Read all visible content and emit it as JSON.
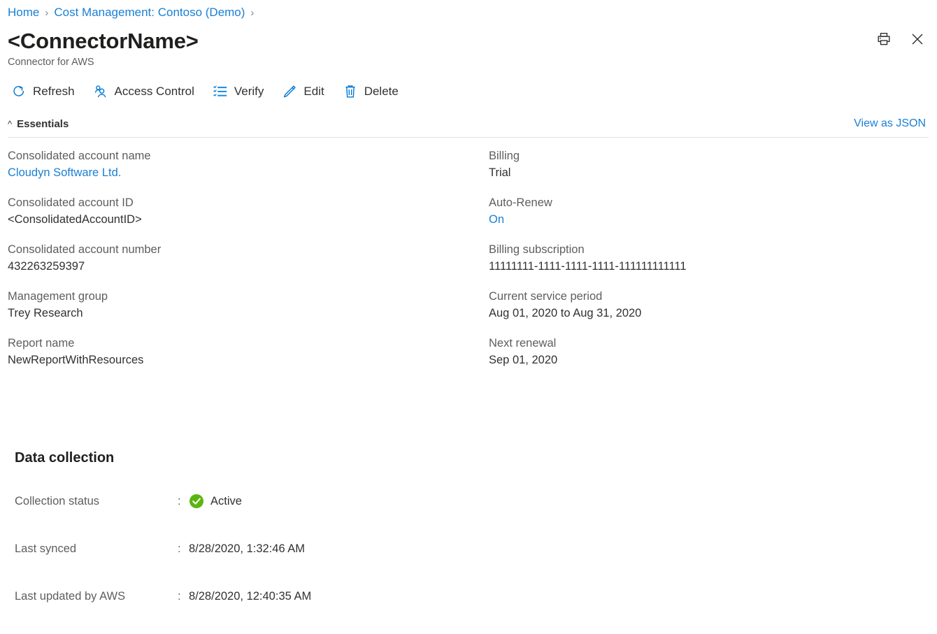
{
  "breadcrumb": {
    "items": [
      {
        "label": "Home"
      },
      {
        "label": "Cost Management: Contoso (Demo)"
      }
    ],
    "separator": "›"
  },
  "header": {
    "title": "<ConnectorName>",
    "subtitle": "Connector for AWS",
    "print_icon": "print-icon",
    "close_icon": "close-icon"
  },
  "command_bar": {
    "items": [
      {
        "label": "Refresh",
        "icon": "refresh-icon"
      },
      {
        "label": "Access Control",
        "icon": "access-control-icon"
      },
      {
        "label": "Verify",
        "icon": "verify-checklist-icon"
      },
      {
        "label": "Edit",
        "icon": "edit-pencil-icon"
      },
      {
        "label": "Delete",
        "icon": "delete-trash-icon"
      }
    ]
  },
  "essentials": {
    "label": "Essentials",
    "collapse_icon": "chevron-up-icon",
    "view_as_json": "View as JSON",
    "left": [
      {
        "key": "Consolidated account name",
        "value": "Cloudyn Software Ltd.",
        "is_link": true
      },
      {
        "key": "Consolidated account ID",
        "value": "<ConsolidatedAccountID>",
        "is_link": false
      },
      {
        "key": "Consolidated account number",
        "value": "432263259397",
        "is_link": false
      },
      {
        "key": "Management group",
        "value": "Trey Research",
        "is_link": false
      },
      {
        "key": "Report name",
        "value": "NewReportWithResources",
        "is_link": false
      }
    ],
    "right": [
      {
        "key": "Billing",
        "value": "Trial",
        "is_link": false
      },
      {
        "key": "Auto-Renew",
        "value": "On",
        "is_link": true
      },
      {
        "key": "Billing subscription",
        "value": "11111111-1111-1111-1111-111111111111",
        "is_link": false
      },
      {
        "key": "Current service period",
        "value": "Aug 01, 2020 to Aug 31, 2020",
        "is_link": false
      },
      {
        "key": "Next renewal",
        "value": "Sep 01, 2020",
        "is_link": false
      }
    ]
  },
  "data_collection": {
    "title": "Data collection",
    "colon": ":",
    "rows": [
      {
        "label": "Collection status",
        "value": "Active",
        "icon": "success-check-icon"
      },
      {
        "label": "Last synced",
        "value": "8/28/2020, 1:32:46 AM",
        "icon": null
      },
      {
        "label": "Last updated by AWS",
        "value": "8/28/2020, 12:40:35 AM",
        "icon": null
      }
    ]
  },
  "colors": {
    "link": "#1a7fd4",
    "accent": "#0078d4",
    "success": "#5bb50f",
    "text": "#323130",
    "muted": "#605e5c"
  }
}
